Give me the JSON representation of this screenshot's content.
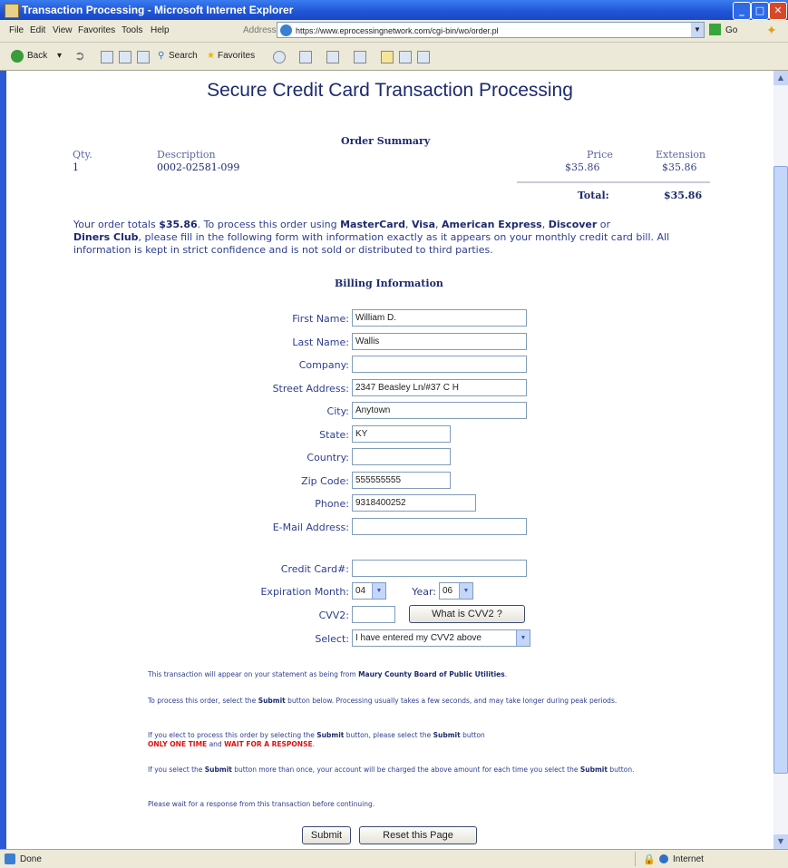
{
  "window": {
    "title": "Transaction Processing - Microsoft Internet Explorer"
  },
  "menu": [
    "File",
    "Edit",
    "View",
    "Favorites",
    "Tools",
    "Help"
  ],
  "address": {
    "label": "Address",
    "url": "https://www.eprocessingnetwork.com/cgi-bin/wo/order.pl",
    "go": "Go"
  },
  "toolbar": {
    "back": "Back",
    "search": "Search",
    "favorites": "Favorites"
  },
  "page": {
    "heading": "Secure Credit Card Transaction Processing",
    "order_summary": "Order Summary",
    "qty_header": "Qty.",
    "desc_header": "Description",
    "price_header": "Price",
    "ext_header": "Extension",
    "row": {
      "qty": "1",
      "desc": "0002-02581-099",
      "price": "$35.86",
      "ext": "$35.86"
    },
    "total_label": "Total:",
    "total_value": "$35.86",
    "intro_1": "Your order totals ",
    "intro_total": "$35.86",
    "intro_2": ". To process this order using ",
    "mc": "MasterCard",
    "c1": ", ",
    "visa": "Visa",
    "c2": ", ",
    "amex": "American Express",
    "c3": ", ",
    "discover": "Discover",
    "or": " or",
    "diners": "Diners Club",
    "intro_3": ", please fill in the following form with information exactly as it appears on your monthly credit card bill. All information is kept in strict confidence and is not sold or distributed to third parties.",
    "billing_header": "Billing Information"
  },
  "form": {
    "first_name": {
      "label": "First Name:",
      "value": "William D."
    },
    "last_name": {
      "label": "Last Name:",
      "value": "Wallis"
    },
    "company": {
      "label": "Company:",
      "value": ""
    },
    "street": {
      "label": "Street Address:",
      "value": "2347 Beasley Ln/#37 C H"
    },
    "city": {
      "label": "City:",
      "value": "Anytown"
    },
    "state": {
      "label": "State:",
      "value": "KY"
    },
    "country": {
      "label": "Country:",
      "value": ""
    },
    "zip": {
      "label": "Zip Code:",
      "value": "555555555"
    },
    "phone": {
      "label": "Phone:",
      "value": "9318400252"
    },
    "email": {
      "label": "E-Mail Address:",
      "value": ""
    },
    "cc": {
      "label": "Credit Card#:",
      "value": ""
    },
    "exp_month": {
      "label": "Expiration Month:",
      "value": "04"
    },
    "exp_year": {
      "label": "Year:",
      "value": "06"
    },
    "cvv2": {
      "label": "CVV2:",
      "value": ""
    },
    "cvv2_button": "What is CVV2 ?",
    "select": {
      "label": "Select:",
      "value": "I have entered my CVV2 above"
    }
  },
  "notes": {
    "n1a": "This transaction will appear on your statement as being from ",
    "n1b": "Maury County Board of Public Utilities",
    "n1c": ".",
    "n2a": "To process this order, select the ",
    "n2b": "Submit",
    "n2c": " button below. Processing usually takes a few seconds, and may take longer during peak periods.",
    "n3a": "If you elect to process this order by selecting the ",
    "n3b": "Submit",
    "n3c": " button, please select the ",
    "n3d": "Submit",
    "n3e": " button",
    "n3f": "ONLY ONE TIME",
    "n3g": " and ",
    "n3h": "WAIT FOR A RESPONSE",
    "n3i": ".",
    "n4a": "If you select the ",
    "n4b": "Submit",
    "n4c": " button more than once, your account will be charged the above amount for each time you select the ",
    "n4d": "Submit",
    "n4e": " button.",
    "n5": "Please wait for a response from this transaction before continuing."
  },
  "buttons": {
    "submit": "Submit",
    "reset": "Reset this Page"
  },
  "status": {
    "left": "Done",
    "zone": "Internet"
  }
}
